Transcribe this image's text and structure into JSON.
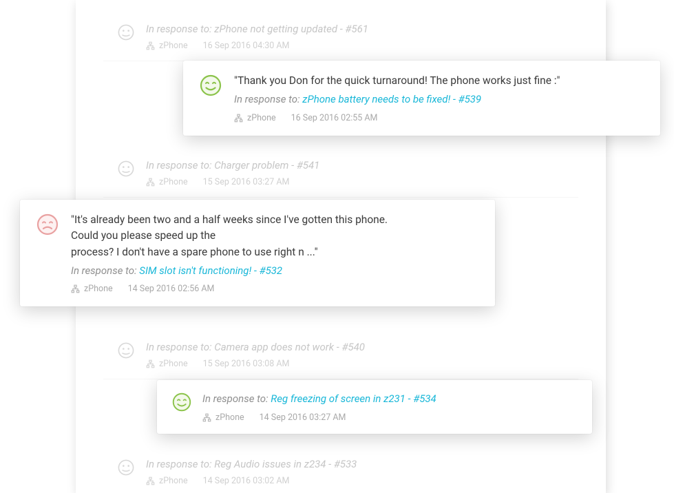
{
  "response_prefix": "In response to: ",
  "cards": {
    "happy1": {
      "quote": "\"Thank you Don for the quick turnaround! The phone works just fine :\"",
      "link": "zPhone battery needs to be fixed! - #539",
      "org": "zPhone",
      "timestamp": "16 Sep 2016 02:55 AM"
    },
    "sad1": {
      "quote_line1": "\"It's already been two and a half weeks since I've gotten this phone.",
      "quote_line2": "Could you please speed up the",
      "quote_line3": "process? I don't have a spare phone to use right n ...\"",
      "link": "SIM slot isn't functioning! - #532",
      "org": "zPhone",
      "timestamp": "14 Sep 2016 02:56 AM"
    },
    "happy2": {
      "link": "Reg freezing of screen in z231 - #534",
      "org": "zPhone",
      "timestamp": "14 Sep 2016 03:27 AM"
    }
  },
  "bg_entries": {
    "e1": {
      "title": "zPhone not getting updated - #561",
      "org": "zPhone",
      "timestamp": "16 Sep 2016 04:30 AM"
    },
    "e2": {
      "title": "Charger problem - #541",
      "org": "zPhone",
      "timestamp": "15 Sep 2016 03:27 AM"
    },
    "e3": {
      "title": "Camera app does not work - #540",
      "org": "zPhone",
      "timestamp": "15 Sep 2016 03:08 AM"
    },
    "e4": {
      "title": "Reg Audio issues in z234 - #533",
      "org": "zPhone",
      "timestamp": "14 Sep 2016 03:02 AM"
    }
  }
}
